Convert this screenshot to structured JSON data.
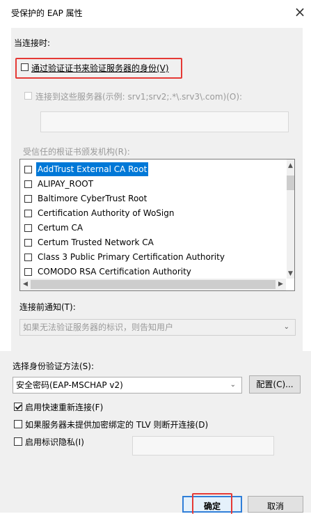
{
  "window": {
    "title": "受保护的 EAP 属性",
    "close_symbol": "×"
  },
  "connect_section": {
    "heading": "当连接时:",
    "verify_cert_label": "通过验证证书来验证服务器的身份(V)",
    "connect_servers_label": "连接到这些服务器(示例: srv1;srv2;.*\\.srv3\\.com)(O):",
    "servers_value": ""
  },
  "trusted_ca": {
    "heading": "受信任的根证书颁发机构(R):",
    "items": [
      {
        "label": "AddTrust External CA Root",
        "checked": false,
        "selected": true
      },
      {
        "label": "ALIPAY_ROOT",
        "checked": false,
        "selected": false
      },
      {
        "label": "Baltimore CyberTrust Root",
        "checked": false,
        "selected": false
      },
      {
        "label": "Certification Authority of WoSign",
        "checked": false,
        "selected": false
      },
      {
        "label": "Certum CA",
        "checked": false,
        "selected": false
      },
      {
        "label": "Certum Trusted Network CA",
        "checked": false,
        "selected": false
      },
      {
        "label": "Class 3 Public Primary Certification Authority",
        "checked": false,
        "selected": false
      },
      {
        "label": "COMODO RSA Certification Authority",
        "checked": false,
        "selected": false
      }
    ]
  },
  "notify": {
    "heading": "连接前通知(T):",
    "selected": "如果无法验证服务器的标识，则告知用户"
  },
  "auth": {
    "heading": "选择身份验证方法(S):",
    "method": "安全密码(EAP-MSCHAP v2)",
    "configure_label": "配置(C)..."
  },
  "options": {
    "fast_reconnect": {
      "label": "启用快速重新连接(F)",
      "checked": true
    },
    "disconnect_tlv": {
      "label": "如果服务器未提供加密绑定的 TLV 则断开连接(D)",
      "checked": false
    },
    "identity_privacy": {
      "label": "启用标识隐私(I)",
      "checked": false,
      "value": ""
    }
  },
  "buttons": {
    "ok": "确定",
    "cancel": "取消"
  },
  "colors": {
    "highlight": "#e53935",
    "selection": "#0078d7"
  }
}
